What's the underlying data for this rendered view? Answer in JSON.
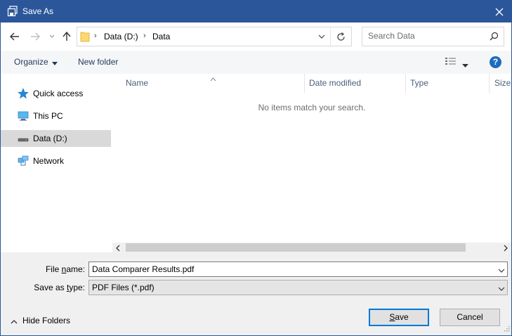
{
  "window": {
    "title": "Save As",
    "close_icon": "close-icon"
  },
  "nav": {
    "back_icon": "arrow-left-icon",
    "forward_icon": "arrow-right-icon",
    "recent_icon": "chevron-down-icon",
    "up_icon": "arrow-up-icon",
    "breadcrumb": [
      "Data (D:)",
      "Data"
    ],
    "refresh_icon": "refresh-icon",
    "search_placeholder": "Search Data"
  },
  "toolbar": {
    "organize_label": "Organize",
    "new_folder_label": "New folder",
    "view_icon": "details-view-icon",
    "help_label": "?"
  },
  "sidebar": {
    "items": [
      {
        "label": "Quick access",
        "icon": "star-icon"
      },
      {
        "label": "This PC",
        "icon": "computer-icon"
      },
      {
        "label": "Data (D:)",
        "icon": "drive-icon",
        "selected": true
      },
      {
        "label": "Network",
        "icon": "network-icon"
      }
    ]
  },
  "filelist": {
    "columns": [
      "Name",
      "Date modified",
      "Type",
      "Size"
    ],
    "empty_message": "No items match your search."
  },
  "form": {
    "file_name_label_prefix": "File ",
    "file_name_label_accel": "n",
    "file_name_label_suffix": "ame:",
    "file_name_value": "Data Comparer Results.pdf",
    "save_type_label_prefix": "Save as ",
    "save_type_label_accel": "t",
    "save_type_label_suffix": "ype:",
    "save_type_value": "PDF Files (*.pdf)",
    "hide_folders_label": "Hide Folders",
    "save_label_accel": "S",
    "save_label_rest": "ave",
    "cancel_label": "Cancel"
  },
  "colors": {
    "titlebar": "#2b579a",
    "selection": "#d9d9d9",
    "accent": "#0078d7"
  }
}
